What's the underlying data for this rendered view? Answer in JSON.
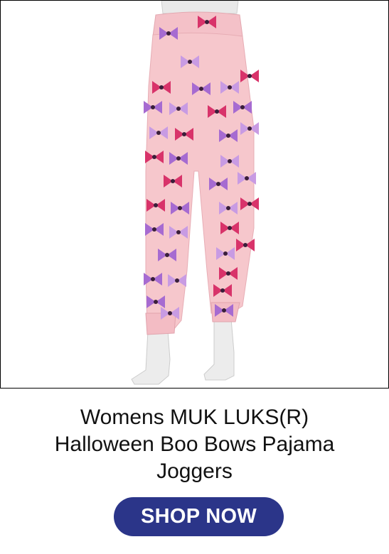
{
  "product": {
    "title_lines": [
      "Womens MUK LUKS(R)",
      "Halloween Boo Bows Pajama",
      "Joggers"
    ],
    "image_subject": "pink pajama joggers with bow print on mannequin",
    "colors": {
      "fabric": "#f6c7cc",
      "bow_magenta": "#d8336a",
      "bow_purple": "#a66bd1",
      "bow_lavender": "#c89be3",
      "mannequin": "#eeeeee"
    }
  },
  "cta": {
    "label": "SHOP NOW",
    "background": "#2b3589",
    "text_color": "#ffffff"
  }
}
